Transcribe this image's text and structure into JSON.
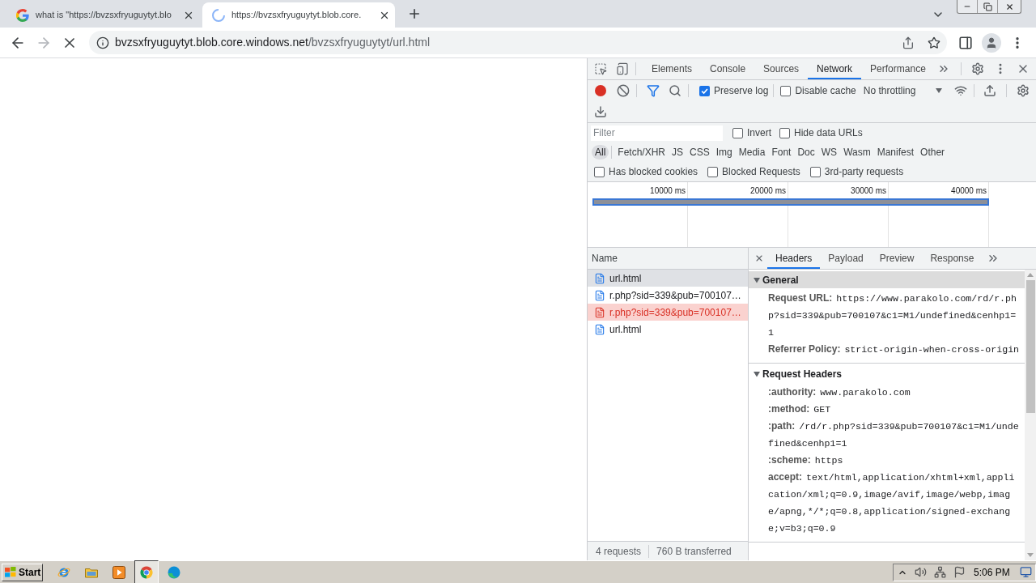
{
  "browser": {
    "tabs": [
      {
        "title": "what is \"https://bvzsxfryuguytyt.blo",
        "selected": false,
        "loading": false
      },
      {
        "title": "https://bvzsxfryuguytyt.blob.core.",
        "selected": true,
        "loading": true
      }
    ],
    "loading": true,
    "address": {
      "host": "bvzsxfryuguytyt.blob.core.windows.net",
      "path": "/bvzsxfryuguytyt/url.html"
    }
  },
  "devtools": {
    "panels": [
      {
        "label": "Elements",
        "selected": false
      },
      {
        "label": "Console",
        "selected": false
      },
      {
        "label": "Sources",
        "selected": false
      },
      {
        "label": "Network",
        "selected": true
      },
      {
        "label": "Performance",
        "selected": false
      }
    ],
    "network_toolbar": {
      "recording": true,
      "options": [
        {
          "label": "Preserve log",
          "checked": true
        },
        {
          "label": "Disable cache",
          "checked": false
        }
      ],
      "throttling": "No throttling"
    },
    "filter": {
      "placeholder": "Filter",
      "options": [
        {
          "label": "Invert",
          "checked": false
        },
        {
          "label": "Hide data URLs",
          "checked": false
        }
      ]
    },
    "types": [
      {
        "label": "All",
        "selected": true
      },
      {
        "label": "Fetch/XHR",
        "selected": false
      },
      {
        "label": "JS",
        "selected": false
      },
      {
        "label": "CSS",
        "selected": false
      },
      {
        "label": "Img",
        "selected": false
      },
      {
        "label": "Media",
        "selected": false
      },
      {
        "label": "Font",
        "selected": false
      },
      {
        "label": "Doc",
        "selected": false
      },
      {
        "label": "WS",
        "selected": false
      },
      {
        "label": "Wasm",
        "selected": false
      },
      {
        "label": "Manifest",
        "selected": false
      },
      {
        "label": "Other",
        "selected": false
      }
    ],
    "more_filters": [
      {
        "label": "Has blocked cookies",
        "checked": false
      },
      {
        "label": "Blocked Requests",
        "checked": false
      },
      {
        "label": "3rd-party requests",
        "checked": false
      }
    ],
    "overview": {
      "ticks": [
        "10000 ms",
        "20000 ms",
        "30000 ms",
        "40000 ms"
      ]
    },
    "requests": {
      "column": "Name",
      "rows": [
        {
          "name": "url.html",
          "selected": false,
          "failed": false,
          "hovered": true
        },
        {
          "name": "r.php?sid=339&pub=700107…",
          "selected": false,
          "failed": false,
          "hovered": false
        },
        {
          "name": "r.php?sid=339&pub=700107…",
          "selected": true,
          "failed": true,
          "hovered": false
        },
        {
          "name": "url.html",
          "selected": false,
          "failed": false,
          "hovered": false
        }
      ]
    },
    "summary": [
      "4 requests",
      "760 B transferred"
    ],
    "details": {
      "tabs": [
        {
          "label": "Headers",
          "selected": true
        },
        {
          "label": "Payload",
          "selected": false
        },
        {
          "label": "Preview",
          "selected": false
        },
        {
          "label": "Response",
          "selected": false
        }
      ],
      "sections": [
        {
          "title": "General",
          "expanded": true,
          "hovered": true,
          "rows": [
            {
              "name": "Request URL:",
              "value": "https://www.parakolo.com/rd/r.php?sid=339&pub=700107&c1=M1/undefined&cenhp1=1"
            },
            {
              "name": "Referrer Policy:",
              "value": "strict-origin-when-cross-origin"
            }
          ]
        },
        {
          "title": "Request Headers",
          "expanded": true,
          "hovered": false,
          "rows": [
            {
              "name": ":authority:",
              "value": "www.parakolo.com"
            },
            {
              "name": ":method:",
              "value": "GET"
            },
            {
              "name": ":path:",
              "value": "/rd/r.php?sid=339&pub=700107&c1=M1/undefined&cenhp1=1"
            },
            {
              "name": ":scheme:",
              "value": "https"
            },
            {
              "name": "accept:",
              "value": "text/html,application/xhtml+xml,application/xml;q=0.9,image/avif,image/webp,image/apng,*/*;q=0.8,application/signed-exchange;v=b3;q=0.9"
            }
          ]
        }
      ]
    }
  },
  "taskbar": {
    "start": "Start",
    "apps": [
      {
        "kind": "ie",
        "selected": false
      },
      {
        "kind": "folder",
        "selected": false
      },
      {
        "kind": "player",
        "selected": false
      },
      {
        "kind": "chrome",
        "selected": true
      },
      {
        "kind": "edge",
        "selected": false
      }
    ],
    "clock": "5:06 PM"
  }
}
